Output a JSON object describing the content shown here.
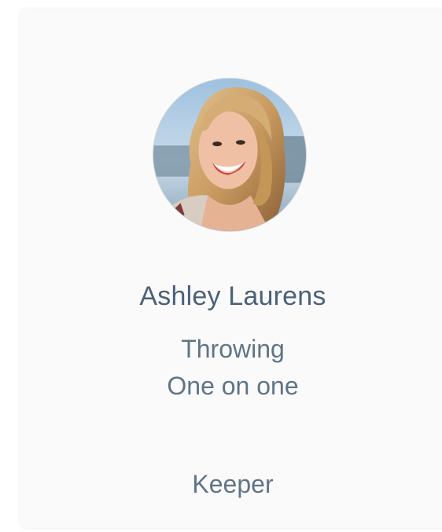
{
  "profile": {
    "name": "Ashley Laurens",
    "skills": [
      "Throwing",
      "One on one"
    ],
    "role": "Keeper"
  },
  "colors": {
    "name_text": "#4b6178",
    "secondary_text": "#607487",
    "card_background": "#fafafa"
  }
}
